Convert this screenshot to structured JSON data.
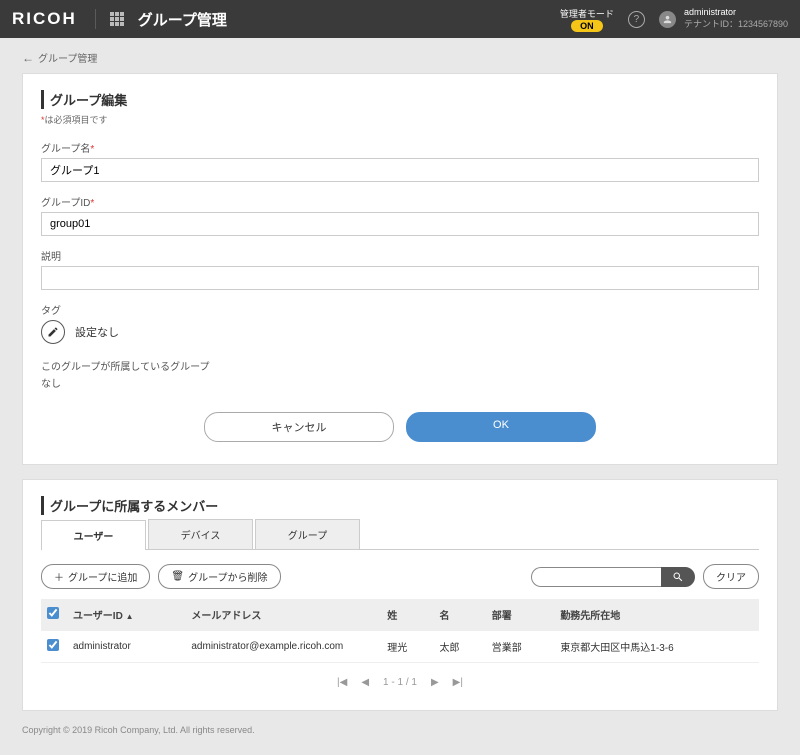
{
  "header": {
    "logo": "RICOH",
    "page_title": "グループ管理",
    "admin_mode_label": "管理者モード",
    "admin_mode_toggle": "ON",
    "username": "administrator",
    "tenant": "テナントID：1234567890"
  },
  "breadcrumb": "グループ管理",
  "edit": {
    "section_title": "グループ編集",
    "required_note_prefix": "*",
    "required_note": "は必須項目です",
    "group_name_label": "グループ名",
    "group_name_value": "グループ1",
    "group_id_label": "グループID",
    "group_id_value": "group01",
    "description_label": "説明",
    "description_value": "",
    "tag_label": "タグ",
    "tag_value": "設定なし",
    "parent_label": "このグループが所属しているグループ",
    "parent_value": "なし",
    "cancel": "キャンセル",
    "ok": "OK"
  },
  "members": {
    "section_title": "グループに所属するメンバー",
    "tabs": {
      "user": "ユーザー",
      "device": "デバイス",
      "group": "グループ"
    },
    "add_btn": "グループに追加",
    "remove_btn": "グループから削除",
    "clear_btn": "クリア",
    "columns": {
      "user_id": "ユーザーID",
      "email": "メールアドレス",
      "lastname": "姓",
      "firstname": "名",
      "department": "部署",
      "location": "勤務先所在地"
    },
    "rows": [
      {
        "user_id": "administrator",
        "email": "administrator@example.ricoh.com",
        "lastname": "理光",
        "firstname": "太郎",
        "department": "営業部",
        "location": "東京都大田区中馬込1-3-6"
      }
    ],
    "pagination": "1 - 1 / 1"
  },
  "footer": "Copyright © 2019 Ricoh Company, Ltd. All rights reserved."
}
